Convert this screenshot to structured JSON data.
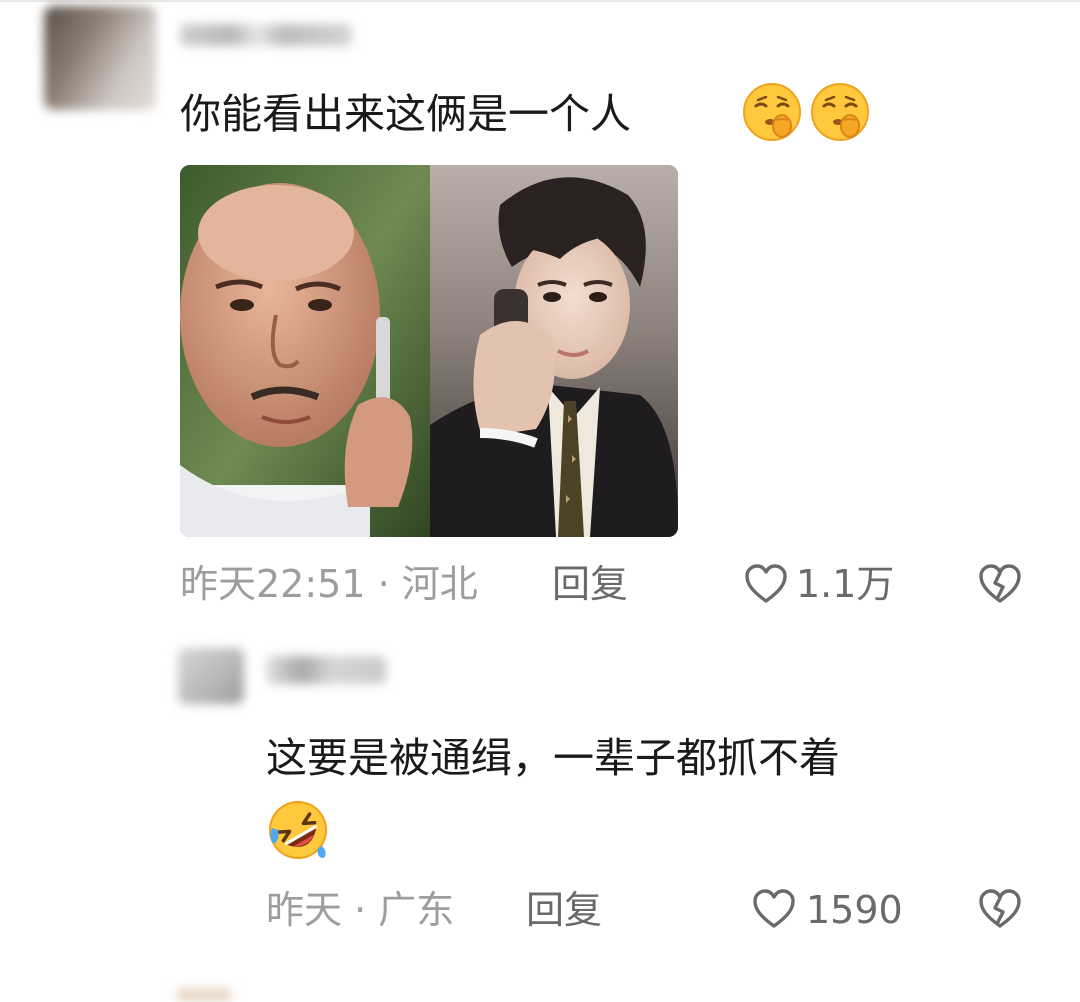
{
  "comments": [
    {
      "text": "你能看出来这俩是一个人",
      "emojis": [
        "shush-face",
        "shush-face"
      ],
      "image": {
        "left": "bald-man-on-phone",
        "right": "young-man-in-suit-on-phone"
      },
      "time_location": "昨天22:51 · 河北",
      "reply_label": "回复",
      "like_count": "1.1万"
    },
    {
      "text": "这要是被通缉，一辈子都抓不着",
      "emojis": [
        "rolling-on-floor-laughing"
      ],
      "time_location": "昨天 · 广东",
      "reply_label": "回复",
      "like_count": "1590"
    }
  ],
  "icons": [
    "heart-icon",
    "broken-heart-icon"
  ],
  "colors": {
    "meta_gray": "#9d9d9d",
    "action_gray": "#6a6a6a",
    "text": "#1a1a1a",
    "emoji_yellow": "#ffc83d"
  }
}
